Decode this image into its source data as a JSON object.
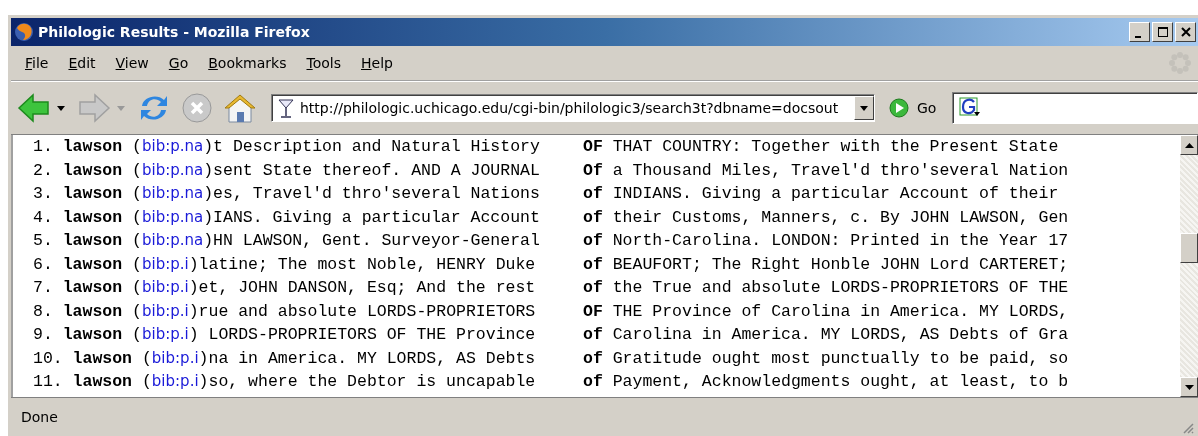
{
  "window": {
    "title": "Philologic Results - Mozilla Firefox"
  },
  "menu": [
    {
      "label": "File"
    },
    {
      "label": "Edit"
    },
    {
      "label": "View"
    },
    {
      "label": "Go"
    },
    {
      "label": "Bookmarks"
    },
    {
      "label": "Tools"
    },
    {
      "label": "Help"
    }
  ],
  "toolbar": {
    "back_disabled": false,
    "forward_disabled": true,
    "stop_disabled": true
  },
  "address": {
    "value": "http://philologic.uchicago.edu/cgi-bin/philologic3/search3t?dbname=docsout"
  },
  "go": {
    "label": "Go"
  },
  "results": [
    {
      "number": "1.",
      "author": "lawson",
      "open": "(",
      "link": "bib:p.na",
      "left": ")t Description and Natural History",
      "keyword": "OF",
      "right": "THAT COUNTRY: Together with the Present State"
    },
    {
      "number": "2.",
      "author": "lawson",
      "open": "(",
      "link": "bib:p.na",
      "left": ")sent State thereof. AND A JOURNAL",
      "keyword": "Of",
      "right": "a Thousand Miles, Travel'd thro'several Nation"
    },
    {
      "number": "3.",
      "author": "lawson",
      "open": "(",
      "link": "bib:p.na",
      "left": ")es, Travel'd thro'several Nations",
      "keyword": "of",
      "right": "INDIANS. Giving a particular Account of their"
    },
    {
      "number": "4.",
      "author": "lawson",
      "open": "(",
      "link": "bib:p.na",
      "left": ")IANS. Giving a particular Account",
      "keyword": "of",
      "right": "their Customs, Manners, c. By JOHN LAWSON, Gen"
    },
    {
      "number": "5.",
      "author": "lawson",
      "open": "(",
      "link": "bib:p.na",
      "left": ")HN LAWSON, Gent. Surveyor-General",
      "keyword": "of",
      "right": "North-Carolina. LONDON: Printed in the Year 17"
    },
    {
      "number": "6.",
      "author": "lawson",
      "open": "(",
      "link": "bib:p.i",
      "left": ")latine; The most Noble, HENRY Duke",
      "keyword": "of",
      "right": "BEAUFORT; The Right Honble JOHN Lord CARTERET;"
    },
    {
      "number": "7.",
      "author": "lawson",
      "open": "(",
      "link": "bib:p.i",
      "left": ")et, JOHN DANSON, Esq; And the rest",
      "keyword": "of",
      "right": "the True and absolute LORDS-PROPRIETORS OF THE"
    },
    {
      "number": "8.",
      "author": "lawson",
      "open": "(",
      "link": "bib:p.i",
      "left": ")rue and absolute LORDS-PROPRIETORS",
      "keyword": "OF",
      "right": "THE Province of Carolina in America. MY LORDS,"
    },
    {
      "number": "9.",
      "author": "lawson",
      "open": "(",
      "link": "bib:p.i",
      "left": ") LORDS-PROPRIETORS OF THE Province",
      "keyword": "of",
      "right": "Carolina in America. MY LORDS, AS Debts of Gra"
    },
    {
      "number": "10.",
      "author": "lawson",
      "open": "(",
      "link": "bib:p.i",
      "left": ")na in America. MY LORDS, AS Debts",
      "keyword": "of",
      "right": "Gratitude ought most punctually to be paid, so"
    },
    {
      "number": "11.",
      "author": "lawson",
      "open": "(",
      "link": "bib:p.i",
      "left": ")so, where the Debtor is uncapable",
      "keyword": "of",
      "right": "Payment, Acknowledgments ought, at least, to b"
    }
  ],
  "status_bar": {
    "text": "Done"
  }
}
